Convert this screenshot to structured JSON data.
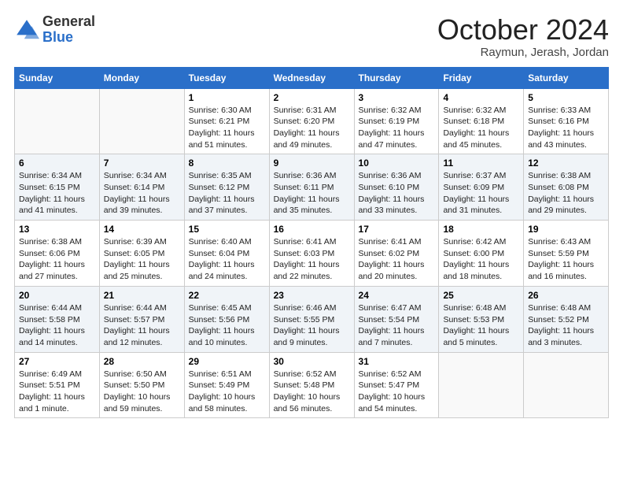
{
  "header": {
    "logo_general": "General",
    "logo_blue": "Blue",
    "title": "October 2024",
    "subtitle": "Raymun, Jerash, Jordan"
  },
  "days_of_week": [
    "Sunday",
    "Monday",
    "Tuesday",
    "Wednesday",
    "Thursday",
    "Friday",
    "Saturday"
  ],
  "weeks": [
    [
      {
        "day": "",
        "info": ""
      },
      {
        "day": "",
        "info": ""
      },
      {
        "day": "1",
        "info": "Sunrise: 6:30 AM\nSunset: 6:21 PM\nDaylight: 11 hours and 51 minutes."
      },
      {
        "day": "2",
        "info": "Sunrise: 6:31 AM\nSunset: 6:20 PM\nDaylight: 11 hours and 49 minutes."
      },
      {
        "day": "3",
        "info": "Sunrise: 6:32 AM\nSunset: 6:19 PM\nDaylight: 11 hours and 47 minutes."
      },
      {
        "day": "4",
        "info": "Sunrise: 6:32 AM\nSunset: 6:18 PM\nDaylight: 11 hours and 45 minutes."
      },
      {
        "day": "5",
        "info": "Sunrise: 6:33 AM\nSunset: 6:16 PM\nDaylight: 11 hours and 43 minutes."
      }
    ],
    [
      {
        "day": "6",
        "info": "Sunrise: 6:34 AM\nSunset: 6:15 PM\nDaylight: 11 hours and 41 minutes."
      },
      {
        "day": "7",
        "info": "Sunrise: 6:34 AM\nSunset: 6:14 PM\nDaylight: 11 hours and 39 minutes."
      },
      {
        "day": "8",
        "info": "Sunrise: 6:35 AM\nSunset: 6:12 PM\nDaylight: 11 hours and 37 minutes."
      },
      {
        "day": "9",
        "info": "Sunrise: 6:36 AM\nSunset: 6:11 PM\nDaylight: 11 hours and 35 minutes."
      },
      {
        "day": "10",
        "info": "Sunrise: 6:36 AM\nSunset: 6:10 PM\nDaylight: 11 hours and 33 minutes."
      },
      {
        "day": "11",
        "info": "Sunrise: 6:37 AM\nSunset: 6:09 PM\nDaylight: 11 hours and 31 minutes."
      },
      {
        "day": "12",
        "info": "Sunrise: 6:38 AM\nSunset: 6:08 PM\nDaylight: 11 hours and 29 minutes."
      }
    ],
    [
      {
        "day": "13",
        "info": "Sunrise: 6:38 AM\nSunset: 6:06 PM\nDaylight: 11 hours and 27 minutes."
      },
      {
        "day": "14",
        "info": "Sunrise: 6:39 AM\nSunset: 6:05 PM\nDaylight: 11 hours and 25 minutes."
      },
      {
        "day": "15",
        "info": "Sunrise: 6:40 AM\nSunset: 6:04 PM\nDaylight: 11 hours and 24 minutes."
      },
      {
        "day": "16",
        "info": "Sunrise: 6:41 AM\nSunset: 6:03 PM\nDaylight: 11 hours and 22 minutes."
      },
      {
        "day": "17",
        "info": "Sunrise: 6:41 AM\nSunset: 6:02 PM\nDaylight: 11 hours and 20 minutes."
      },
      {
        "day": "18",
        "info": "Sunrise: 6:42 AM\nSunset: 6:00 PM\nDaylight: 11 hours and 18 minutes."
      },
      {
        "day": "19",
        "info": "Sunrise: 6:43 AM\nSunset: 5:59 PM\nDaylight: 11 hours and 16 minutes."
      }
    ],
    [
      {
        "day": "20",
        "info": "Sunrise: 6:44 AM\nSunset: 5:58 PM\nDaylight: 11 hours and 14 minutes."
      },
      {
        "day": "21",
        "info": "Sunrise: 6:44 AM\nSunset: 5:57 PM\nDaylight: 11 hours and 12 minutes."
      },
      {
        "day": "22",
        "info": "Sunrise: 6:45 AM\nSunset: 5:56 PM\nDaylight: 11 hours and 10 minutes."
      },
      {
        "day": "23",
        "info": "Sunrise: 6:46 AM\nSunset: 5:55 PM\nDaylight: 11 hours and 9 minutes."
      },
      {
        "day": "24",
        "info": "Sunrise: 6:47 AM\nSunset: 5:54 PM\nDaylight: 11 hours and 7 minutes."
      },
      {
        "day": "25",
        "info": "Sunrise: 6:48 AM\nSunset: 5:53 PM\nDaylight: 11 hours and 5 minutes."
      },
      {
        "day": "26",
        "info": "Sunrise: 6:48 AM\nSunset: 5:52 PM\nDaylight: 11 hours and 3 minutes."
      }
    ],
    [
      {
        "day": "27",
        "info": "Sunrise: 6:49 AM\nSunset: 5:51 PM\nDaylight: 11 hours and 1 minute."
      },
      {
        "day": "28",
        "info": "Sunrise: 6:50 AM\nSunset: 5:50 PM\nDaylight: 10 hours and 59 minutes."
      },
      {
        "day": "29",
        "info": "Sunrise: 6:51 AM\nSunset: 5:49 PM\nDaylight: 10 hours and 58 minutes."
      },
      {
        "day": "30",
        "info": "Sunrise: 6:52 AM\nSunset: 5:48 PM\nDaylight: 10 hours and 56 minutes."
      },
      {
        "day": "31",
        "info": "Sunrise: 6:52 AM\nSunset: 5:47 PM\nDaylight: 10 hours and 54 minutes."
      },
      {
        "day": "",
        "info": ""
      },
      {
        "day": "",
        "info": ""
      }
    ]
  ]
}
